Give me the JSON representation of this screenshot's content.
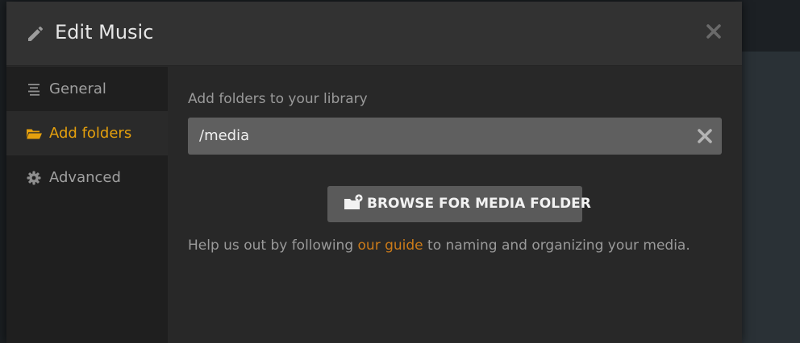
{
  "dialog": {
    "title": "Edit Music",
    "header_icon": "pencil-icon",
    "close_icon": "close-icon"
  },
  "sidebar": {
    "items": [
      {
        "label": "General",
        "icon": "list-icon",
        "active": false
      },
      {
        "label": "Add folders",
        "icon": "folder-open-icon",
        "active": true
      },
      {
        "label": "Advanced",
        "icon": "gear-icon",
        "active": false
      }
    ]
  },
  "content": {
    "section_label": "Add folders to your library",
    "folder_path": "/media",
    "clear_icon": "clear-icon",
    "browse_button": {
      "label": "BROWSE FOR MEDIA FOLDER",
      "icon": "folder-add-icon"
    },
    "help": {
      "before": "Help us out by following ",
      "link": "our guide",
      "after": " to naming and organizing your media."
    }
  },
  "colors": {
    "accent": "#e5a00d",
    "link": "#cc7b19",
    "modal_bg": "#282828",
    "header_bg": "#323232",
    "sidebar_bg": "#1f1f1f",
    "input_bg": "#5f5f5f",
    "button_bg": "#5a5a5a"
  }
}
